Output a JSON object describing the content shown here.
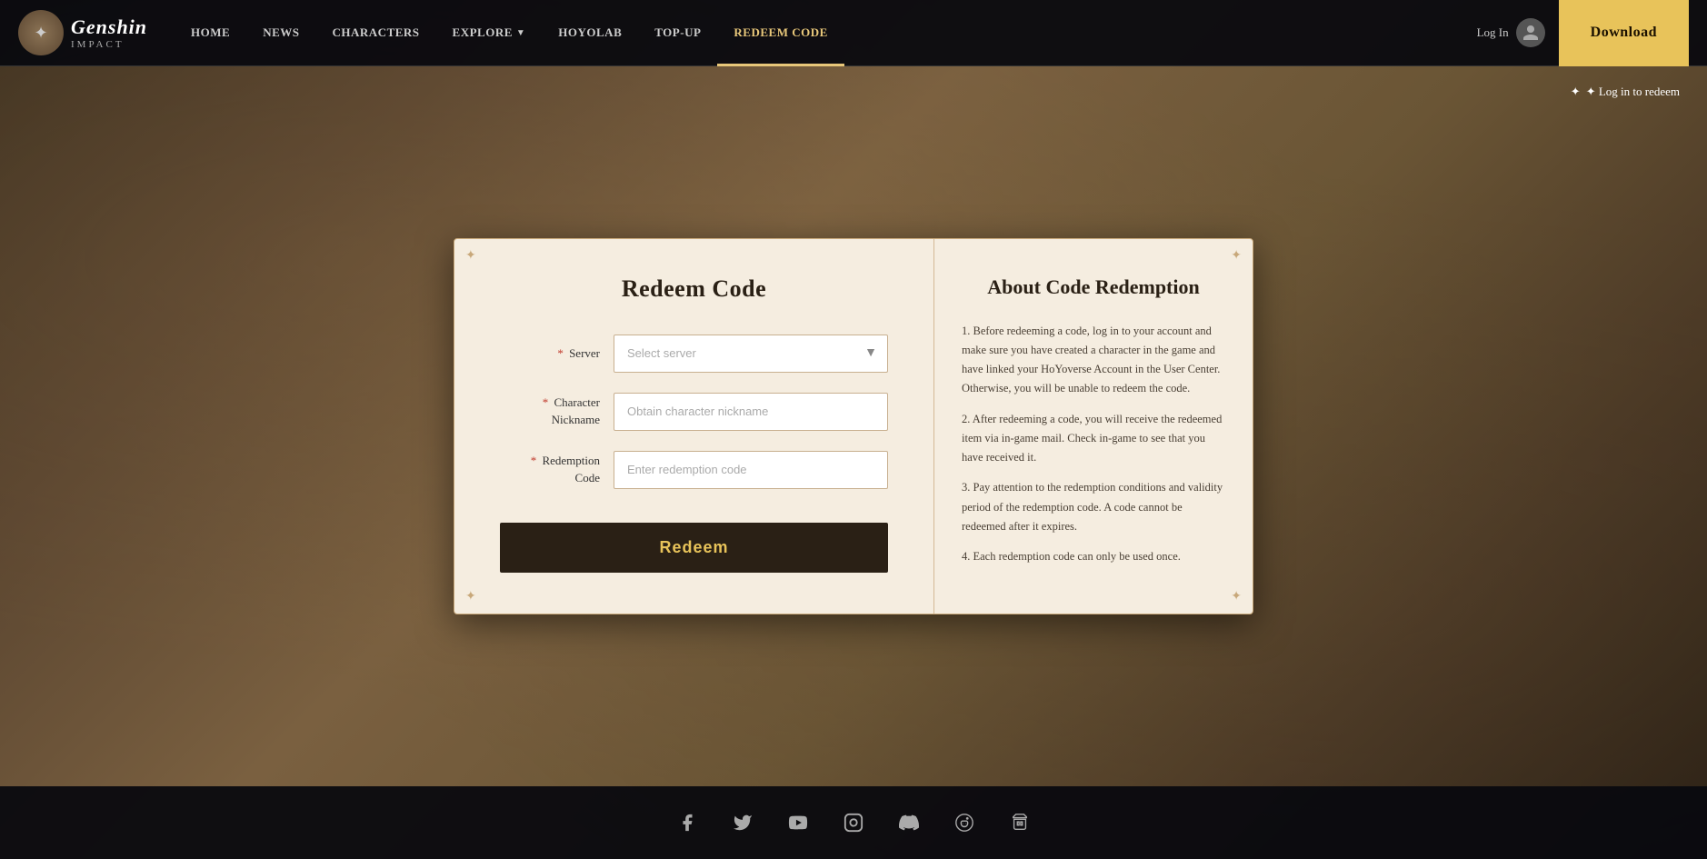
{
  "nav": {
    "logo_main": "Genshin",
    "logo_sub": "IMPACT",
    "items": [
      {
        "label": "HOME",
        "active": false
      },
      {
        "label": "NEWS",
        "active": false
      },
      {
        "label": "CHARACTERS",
        "active": false
      },
      {
        "label": "EXPLORE",
        "active": false,
        "has_dropdown": true
      },
      {
        "label": "HoYoLAB",
        "active": false
      },
      {
        "label": "TOP-UP",
        "active": false
      },
      {
        "label": "REDEEM CODE",
        "active": true
      }
    ],
    "login_label": "Log In",
    "download_label": "Download"
  },
  "page": {
    "login_hint": "✦ Log in to redeem"
  },
  "modal": {
    "title": "Redeem Code",
    "form": {
      "server_label": "Server",
      "server_placeholder": "Select server",
      "nickname_label": "Character\nNickname",
      "nickname_placeholder": "Obtain character nickname",
      "code_label": "Redemption\nCode",
      "code_placeholder": "Enter redemption code",
      "redeem_btn": "Redeem"
    },
    "about": {
      "title": "About Code Redemption",
      "points": [
        "1. Before redeeming a code, log in to your account and make sure you have created a character in the game and have linked your HoYoverse Account in the User Center. Otherwise, you will be unable to redeem the code.",
        "2. After redeeming a code, you will receive the redeemed item via in-game mail. Check in-game to see that you have received it.",
        "3. Pay attention to the redemption conditions and validity period of the redemption code. A code cannot be redeemed after it expires.",
        "4. Each redemption code can only be used once."
      ]
    }
  },
  "footer": {
    "social_icons": [
      {
        "name": "facebook-icon",
        "label": "Facebook"
      },
      {
        "name": "twitter-icon",
        "label": "Twitter"
      },
      {
        "name": "youtube-icon",
        "label": "YouTube"
      },
      {
        "name": "instagram-icon",
        "label": "Instagram"
      },
      {
        "name": "discord-icon",
        "label": "Discord"
      },
      {
        "name": "reddit-icon",
        "label": "Reddit"
      },
      {
        "name": "bilibili-icon",
        "label": "Bilibili"
      }
    ]
  },
  "colors": {
    "accent": "#e8c35a",
    "dark_bg": "#0a0a0f",
    "modal_bg": "#f5ede0"
  }
}
